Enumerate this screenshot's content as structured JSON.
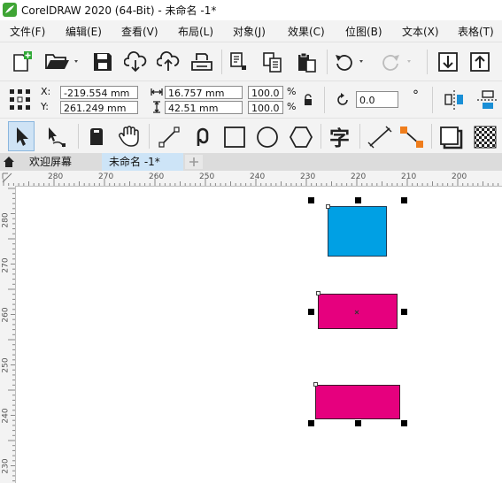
{
  "window": {
    "title": "CorelDRAW 2020 (64-Bit) - 未命名 -1*"
  },
  "menu": [
    {
      "label": "文件(F)"
    },
    {
      "label": "编辑(E)"
    },
    {
      "label": "查看(V)"
    },
    {
      "label": "布局(L)"
    },
    {
      "label": "对象(J)"
    },
    {
      "label": "效果(C)"
    },
    {
      "label": "位图(B)"
    },
    {
      "label": "文本(X)"
    },
    {
      "label": "表格(T)"
    }
  ],
  "property_bar": {
    "x_label": "X:",
    "y_label": "Y:",
    "x_value": "-219.554 mm",
    "y_value": "261.249 mm",
    "width_value": "16.757 mm",
    "height_value": "42.51 mm",
    "scale_x": "100.0",
    "scale_y": "100.0",
    "percent": "%",
    "rotation_value": "0.0",
    "degree_symbol": "°"
  },
  "tabs": [
    {
      "label": "欢迎屏幕",
      "active": false
    },
    {
      "label": "未命名 -1*",
      "active": true
    }
  ],
  "rulers": {
    "horizontal_ticks": [
      "280",
      "270",
      "260",
      "250",
      "240",
      "230",
      "220",
      "210",
      "200"
    ],
    "vertical_ticks": [
      "280",
      "270",
      "260",
      "250",
      "240",
      "230"
    ]
  },
  "shapes": [
    {
      "name": "blue-rectangle",
      "fill": "#00a0e4"
    },
    {
      "name": "magenta-rectangle-middle",
      "fill": "#e6007e",
      "selected": true
    },
    {
      "name": "magenta-rectangle-bottom",
      "fill": "#e6007e",
      "selected": true
    }
  ],
  "icons": [
    "coreldraw-logo",
    "new-document-icon",
    "open-folder-icon",
    "save-icon",
    "cloud-download-icon",
    "cloud-upload-icon",
    "print-icon",
    "copy-icon",
    "paste-icon",
    "clipboard-icon",
    "undo-icon",
    "redo-icon",
    "import-icon",
    "export-icon",
    "lock-ratio-icon",
    "rotate-icon",
    "mirror-horizontal-icon",
    "mirror-vertical-icon",
    "pick-tool-icon",
    "shape-tool-icon",
    "crop-tool-icon",
    "pan-tool-icon",
    "freehand-tool-icon",
    "artistic-media-icon",
    "rectangle-tool-icon",
    "ellipse-tool-icon",
    "polygon-tool-icon",
    "text-tool-icon",
    "parallel-dimension-icon",
    "connector-tool-icon",
    "drop-shadow-icon",
    "transparency-tool-icon",
    "home-icon",
    "add-tab-icon"
  ]
}
